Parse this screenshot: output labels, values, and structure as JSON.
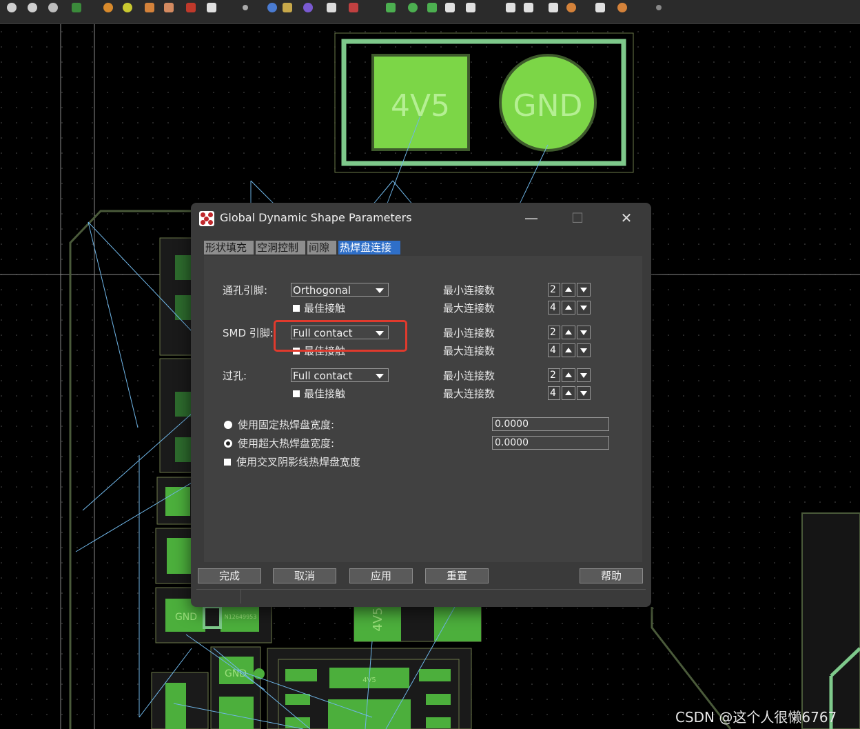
{
  "pcb": {
    "pad_left_label": "4V5",
    "pad_right_label": "GND",
    "small_label_1": "4V5",
    "small_label_2": "GND",
    "small_label_3": "GND",
    "small_label_4": "4V5",
    "small_label_5": "N12649953"
  },
  "dialog": {
    "title": "Global Dynamic Shape Parameters",
    "minimize": "—",
    "maximize": "☐",
    "close": "✕",
    "tabs": [
      {
        "label": "形状填充"
      },
      {
        "label": "空洞控制"
      },
      {
        "label": "间隙"
      },
      {
        "label": "热焊盘连接",
        "active": true
      }
    ],
    "rows": [
      {
        "label": "通孔引脚:",
        "combo": "Orthogonal",
        "best_contact": "最佳接触",
        "min_label": "最小连接数",
        "min_value": "2",
        "max_label": "最大连接数",
        "max_value": "4"
      },
      {
        "label": "SMD 引脚:",
        "combo": "Full contact",
        "best_contact": "最佳接触",
        "min_label": "最小连接数",
        "min_value": "2",
        "max_label": "最大连接数",
        "max_value": "4"
      },
      {
        "label": "过孔:",
        "combo": "Full contact",
        "best_contact": "最佳接触",
        "min_label": "最小连接数",
        "min_value": "2",
        "max_label": "最大连接数",
        "max_value": "4"
      }
    ],
    "fixed_width_label": "使用固定热焊盘宽度:",
    "fixed_width_value": "0.0000",
    "oversize_width_label": "使用超大热焊盘宽度:",
    "oversize_width_value": "0.0000",
    "crosshatch_label": "使用交叉阴影线热焊盘宽度",
    "buttons": {
      "ok": "完成",
      "cancel": "取消",
      "apply": "应用",
      "reset": "重置",
      "help": "帮助"
    }
  },
  "watermark": "CSDN @这个人很懒6767",
  "colors": {
    "pad_green": "#7cd647",
    "outline_green": "#7ec98b",
    "ratsnest_blue": "#6fb6e8",
    "board_outline": "#4a5a3a",
    "highlight_red": "#e03a2d",
    "active_tab": "#2f6fc8"
  }
}
